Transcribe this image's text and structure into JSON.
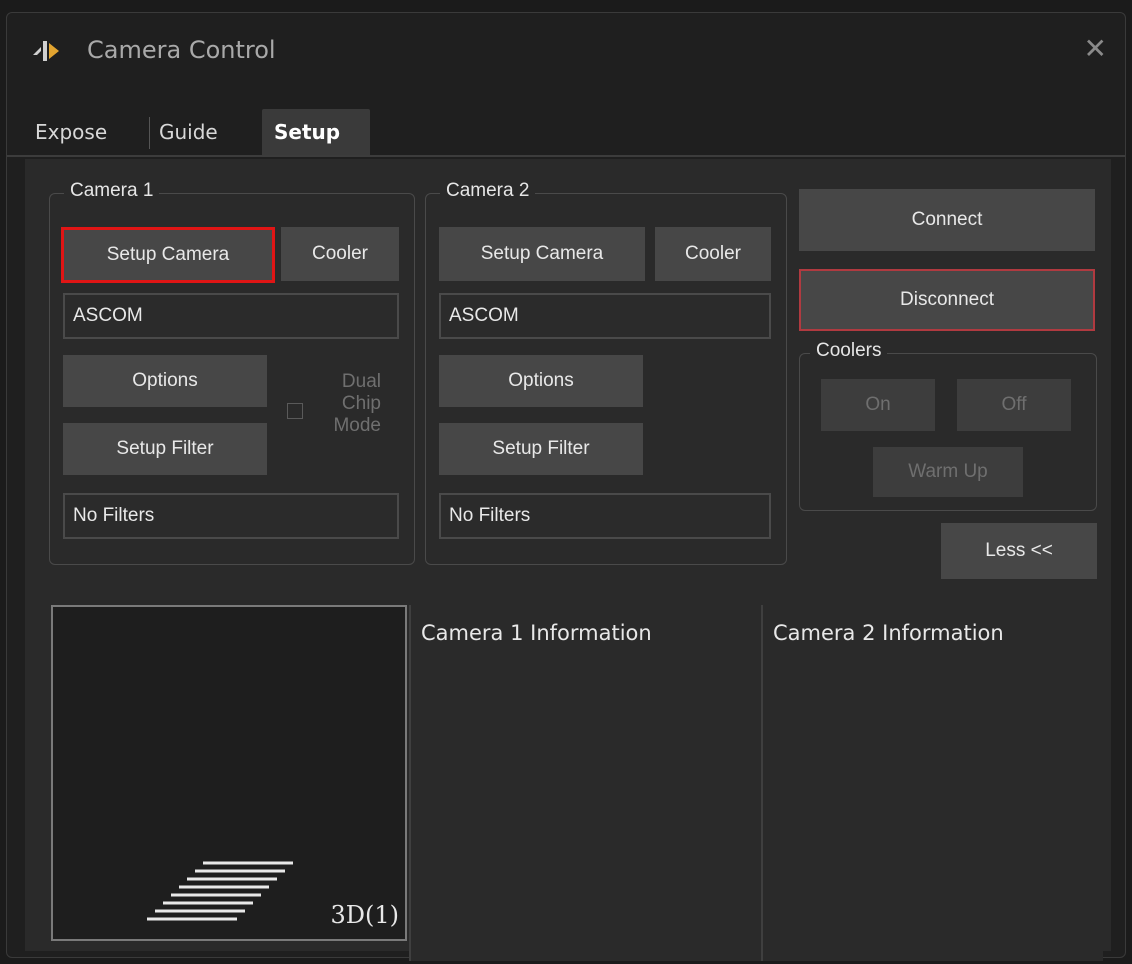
{
  "window": {
    "title": "Camera Control",
    "close_symbol": "✕"
  },
  "tabs": [
    {
      "label": "Expose"
    },
    {
      "label": "Guide"
    },
    {
      "label": "Setup"
    }
  ],
  "camera1": {
    "legend": "Camera 1",
    "setup_camera": "Setup Camera",
    "cooler": "Cooler",
    "driver": "ASCOM",
    "options": "Options",
    "setup_filter": "Setup Filter",
    "filters": "No Filters",
    "dual_chip_lines": [
      "Dual",
      "Chip",
      "Mode"
    ]
  },
  "camera2": {
    "legend": "Camera 2",
    "setup_camera": "Setup Camera",
    "cooler": "Cooler",
    "driver": "ASCOM",
    "options": "Options",
    "setup_filter": "Setup Filter",
    "filters": "No Filters"
  },
  "controls": {
    "connect": "Connect",
    "disconnect": "Disconnect",
    "coolers_legend": "Coolers",
    "on": "On",
    "off": "Off",
    "warm_up": "Warm Up",
    "less": "Less <<"
  },
  "info": {
    "camera1_title": "Camera 1 Information",
    "camera2_title": "Camera 2 Information",
    "preview_label": "3D(1)"
  },
  "colors": {
    "highlight": "#e01515",
    "focus": "#b03a40"
  }
}
